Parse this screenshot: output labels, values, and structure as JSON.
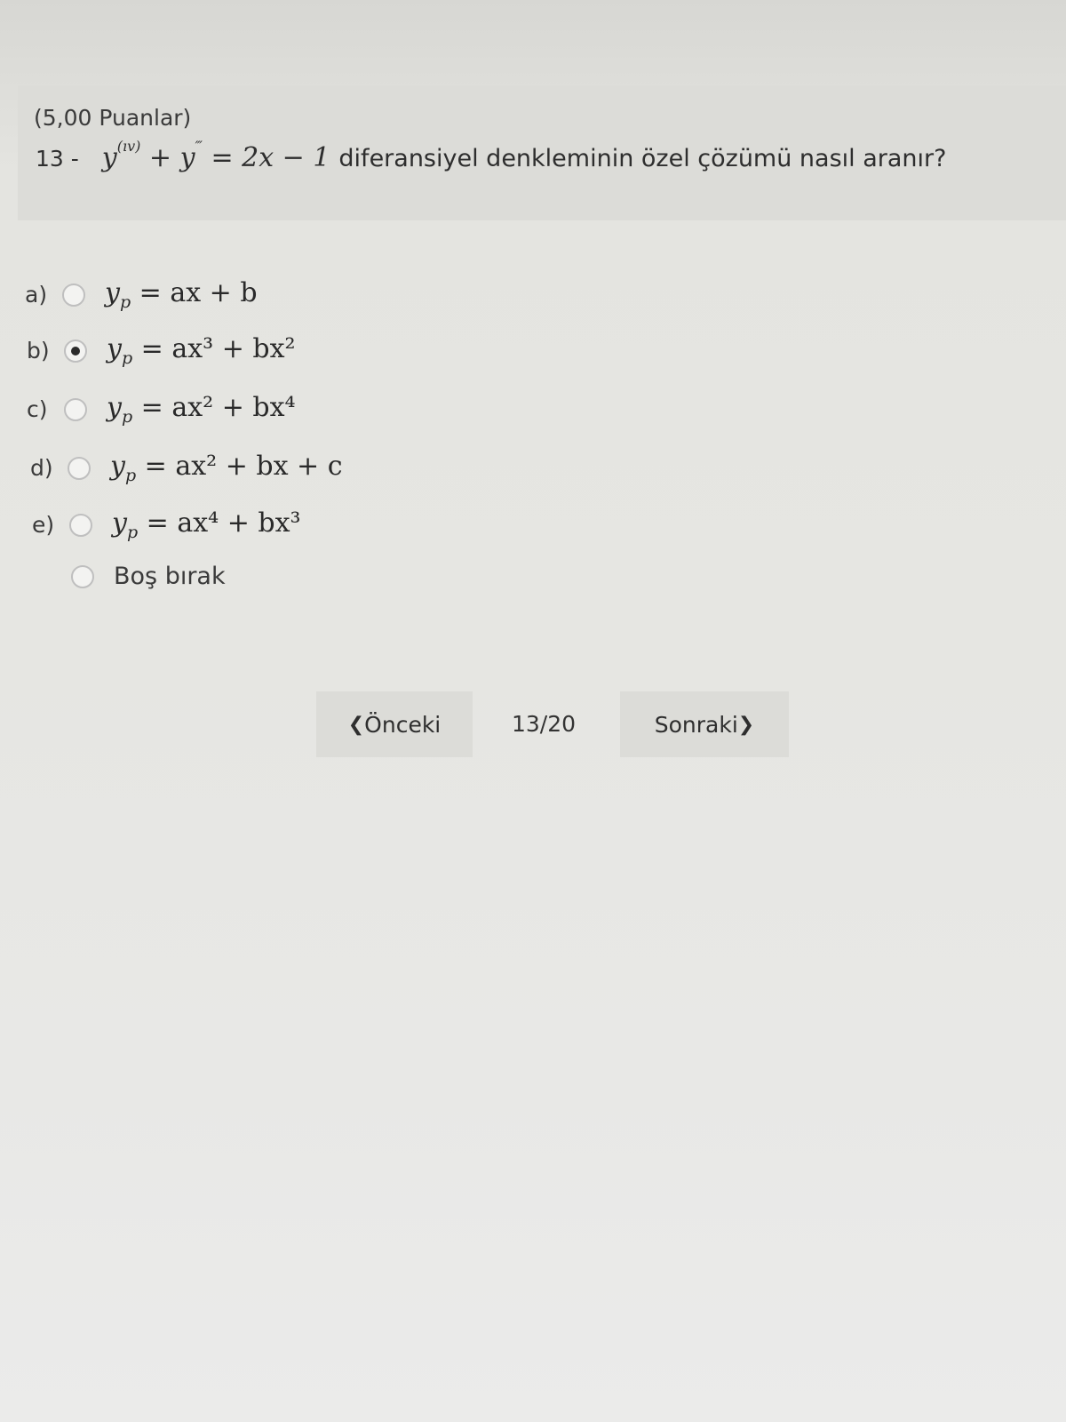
{
  "question": {
    "points": "(5,00 Puanlar)",
    "number": "13 -",
    "equation": {
      "term1_base": "y",
      "term1_sup": "(ıv)",
      "plus": "+",
      "term2_base": "y",
      "term2_sup": "‴",
      "rhs": "= 2x − 1"
    },
    "text": "diferansiyel denkleminin özel çözümü nasıl aranır?"
  },
  "options": [
    {
      "letter": "a)",
      "selected": false,
      "lhs": "y",
      "sub": "p",
      "rhs": "= ax + b"
    },
    {
      "letter": "b)",
      "selected": true,
      "lhs": "y",
      "sub": "p",
      "rhs": "= ax³ + bx²"
    },
    {
      "letter": "c)",
      "selected": false,
      "lhs": "y",
      "sub": "p",
      "rhs": "= ax² + bx⁴"
    },
    {
      "letter": "d)",
      "selected": false,
      "lhs": "y",
      "sub": "p",
      "rhs": "= ax² + bx + c"
    },
    {
      "letter": "e)",
      "selected": false,
      "lhs": "y",
      "sub": "p",
      "rhs": "= ax⁴ + bx³"
    }
  ],
  "skip": {
    "label": "Boş bırak",
    "selected": false
  },
  "navigation": {
    "prev_label": "Önceki",
    "prev_icon": "chevron-left-icon",
    "pager": "13/20",
    "next_label": "Sonraki",
    "next_icon": "chevron-right-icon"
  }
}
